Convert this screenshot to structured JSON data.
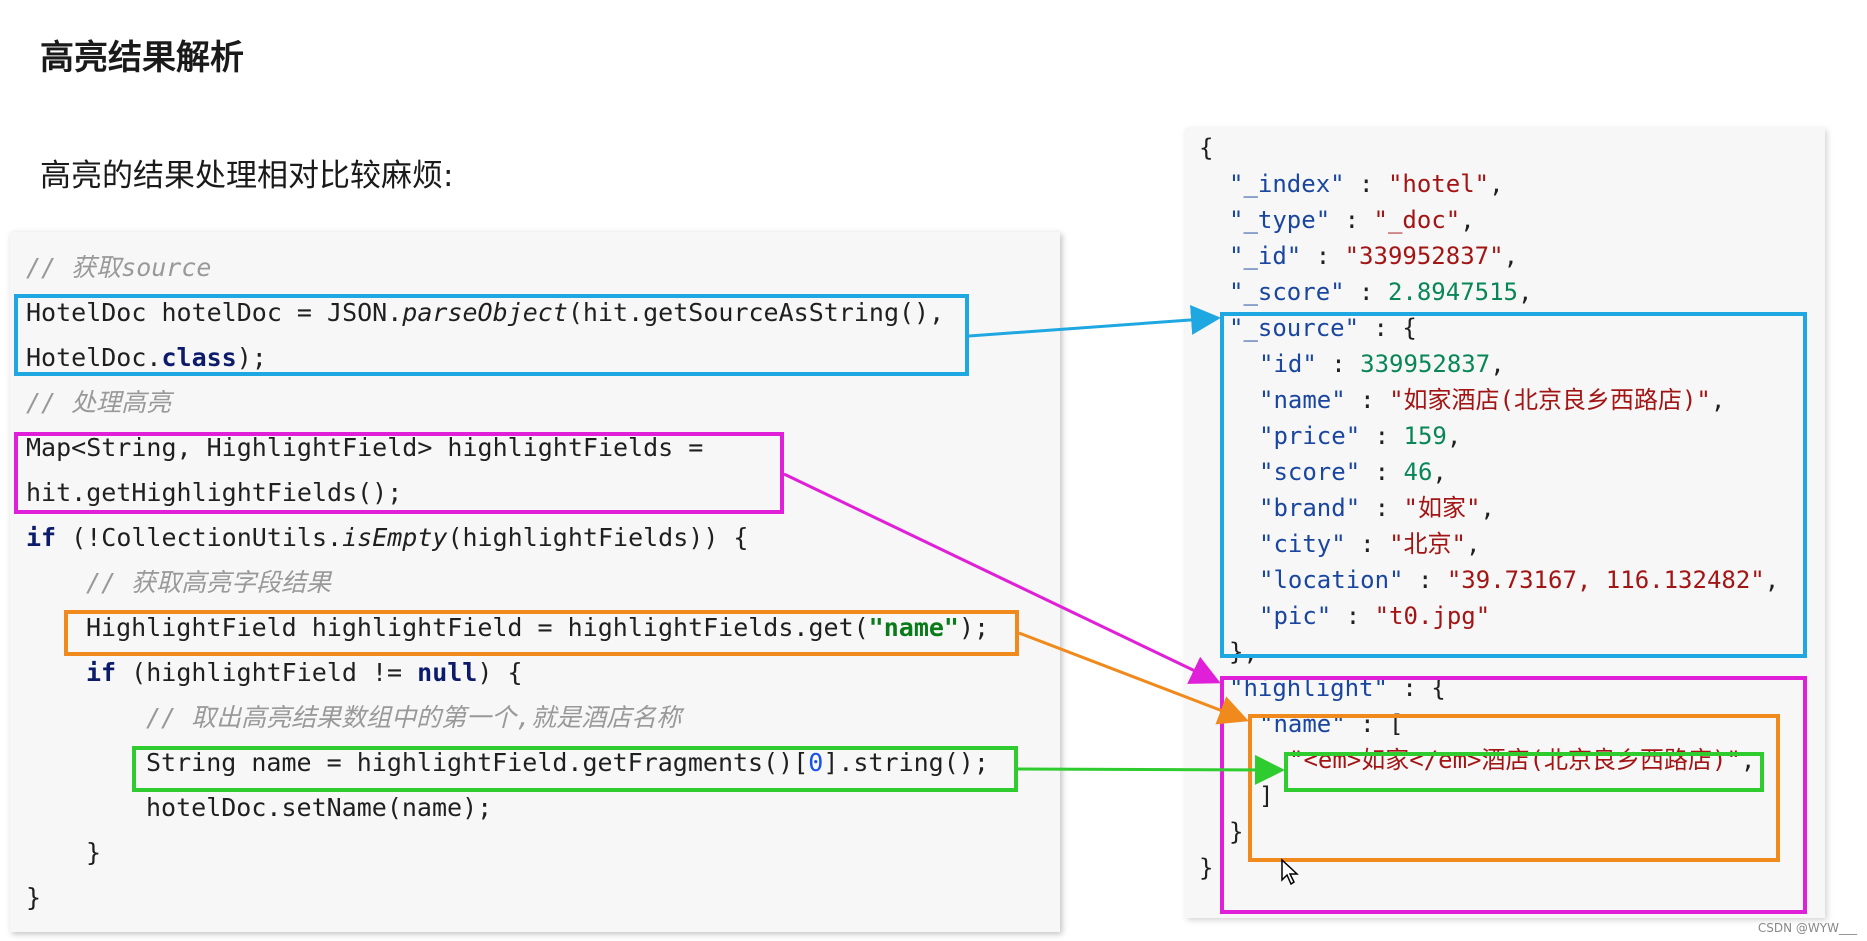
{
  "slide": {
    "title": "高亮结果解析",
    "subtitle": "高亮的结果处理相对比较麻烦:",
    "watermark": "CSDN @WYW___"
  },
  "code": {
    "comment_source": "// 获取source",
    "line_parse_a": "HotelDoc hotelDoc = JSON.",
    "line_parse_b": "parseObject",
    "line_parse_c": "(hit.getSourceAsString(),",
    "line_class_a": "HotelDoc.",
    "line_class_b": "class",
    "line_class_c": ");",
    "comment_highlight": "// 处理高亮",
    "line_map": "Map<String, HighlightField> highlightFields =",
    "line_get": "hit.getHighlightFields();",
    "line_if_a": "if",
    "line_if_b": " (!CollectionUtils.",
    "line_if_c": "isEmpty",
    "line_if_d": "(highlightFields)) {",
    "comment_field": "// 获取高亮字段结果",
    "line_field_a": "HighlightField highlightField = highlightFields.get(",
    "line_field_b": "\"name\"",
    "line_field_c": ");",
    "line_if2_a": "if",
    "line_if2_b": " (highlightField != ",
    "line_if2_c": "null",
    "line_if2_d": ") {",
    "comment_first": "// 取出高亮结果数组中的第一个,就是酒店名称",
    "line_name_a": "String name = highlightField.getFragments()[",
    "line_name_b": "0",
    "line_name_c": "].string();",
    "line_set": "hotelDoc.setName(name);",
    "line_close_inner": "}",
    "line_close_outer": "}"
  },
  "json": {
    "open": "{",
    "index_key": "\"_index\"",
    "index_val": "\"hotel\"",
    "type_key": "\"_type\"",
    "type_val": "\"_doc\"",
    "id_key": "\"_id\"",
    "id_val": "\"339952837\"",
    "score_key": "\"_score\"",
    "score_val": "2.8947515",
    "source_key": "\"_source\"",
    "sid_key": "\"id\"",
    "sid_val": "339952837",
    "name_key": "\"name\"",
    "name_val": "\"如家酒店(北京良乡西路店)\"",
    "price_key": "\"price\"",
    "price_val": "159",
    "sscore_key": "\"score\"",
    "sscore_val": "46",
    "brand_key": "\"brand\"",
    "brand_val": "\"如家\"",
    "city_key": "\"city\"",
    "city_val": "\"北京\"",
    "location_key": "\"location\"",
    "location_val": "\"39.73167, 116.132482\"",
    "pic_key": "\"pic\"",
    "pic_val": "\"t0.jpg\"",
    "source_close": "},",
    "highlight_key": "\"highlight\"",
    "hname_key": "\"name\"",
    "hname_val": "\"<em>如家</em>酒店(北京良乡西路店)\"",
    "array_close": "]",
    "highlight_close": "}",
    "close": "}"
  },
  "colors": {
    "blue": "#1ea7e1",
    "magenta": "#e020d8",
    "orange": "#f08a1c",
    "green": "#2ecc2e"
  }
}
